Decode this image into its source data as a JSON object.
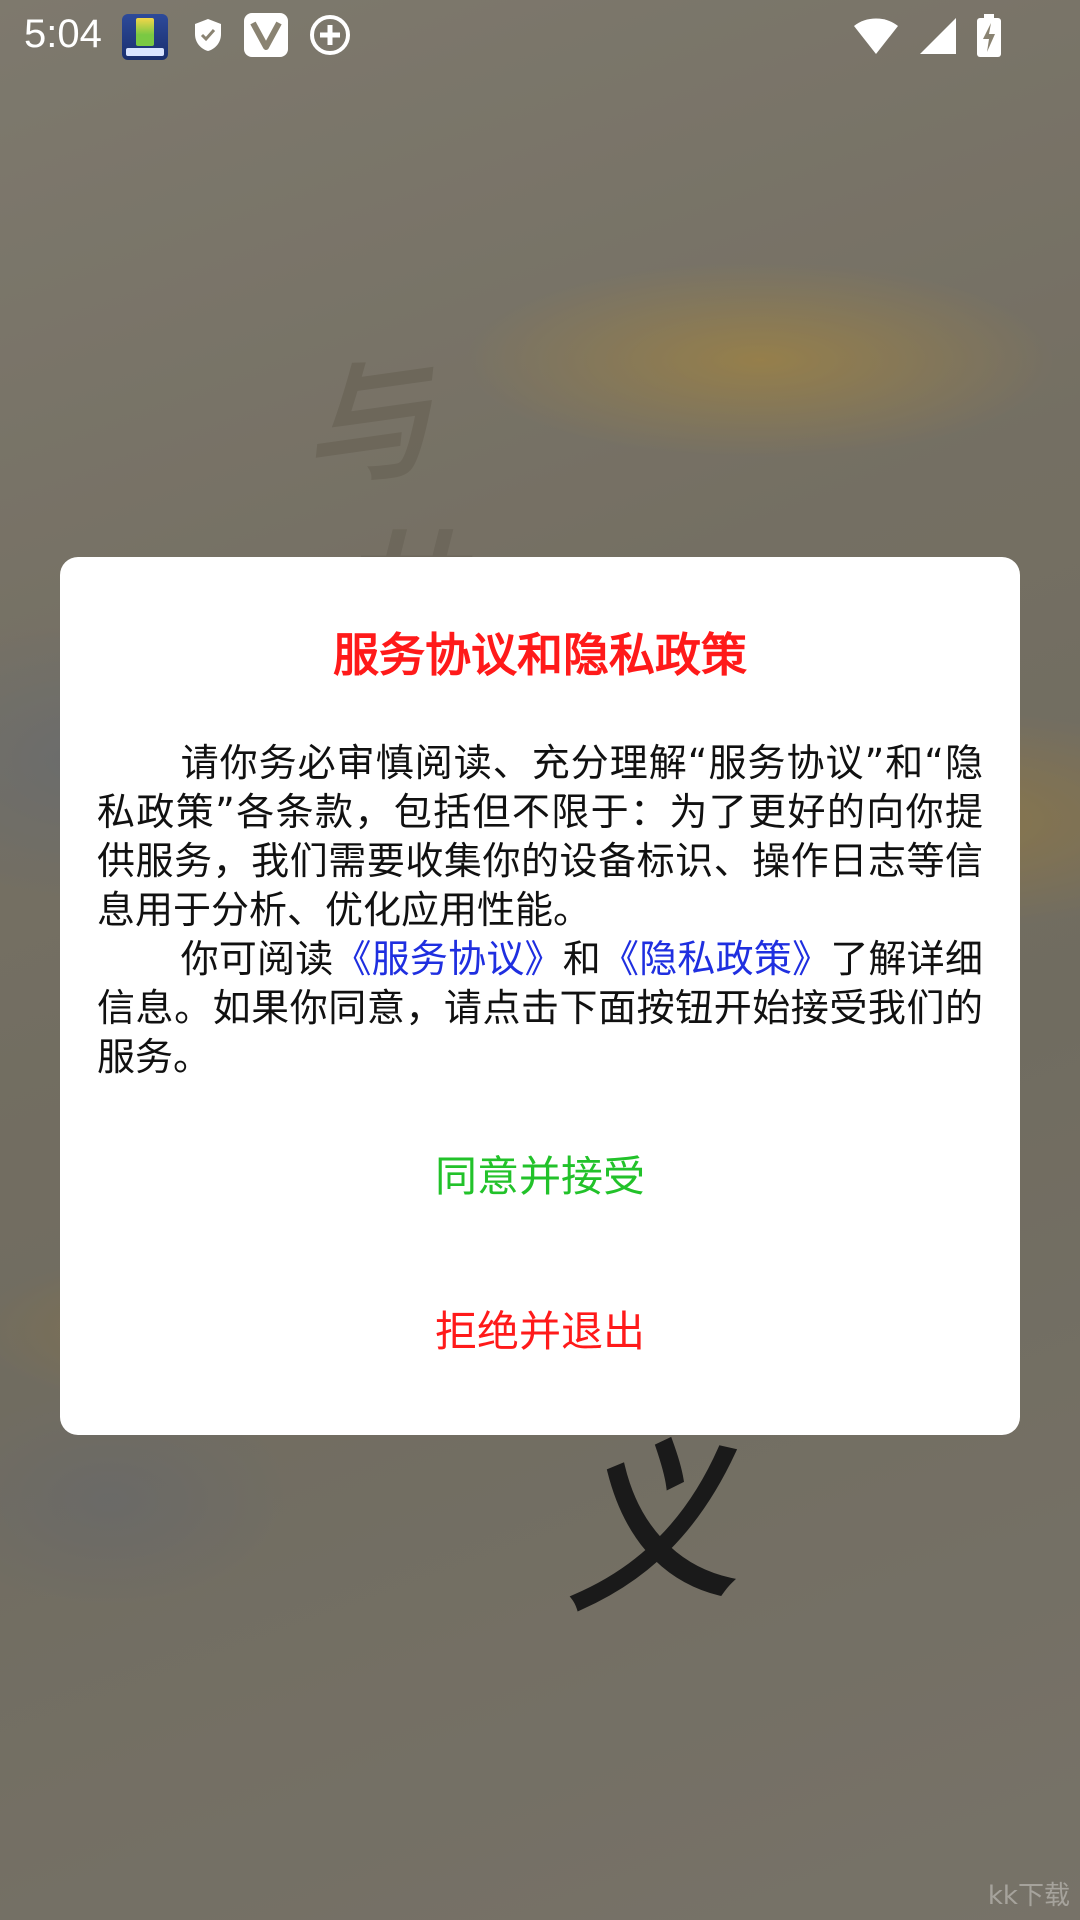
{
  "status_bar": {
    "time": "5:04",
    "left_icons": [
      "battery-app-icon",
      "shield-icon",
      "v-icon",
      "plus-circle-icon"
    ],
    "right_icons": [
      "wifi-icon",
      "signal-icon",
      "battery-charging-icon"
    ]
  },
  "background": {
    "char_top": "与",
    "char_top2": "井",
    "char_bottom": "义",
    "watermark": "kk下载"
  },
  "dialog": {
    "title": "服务协议和隐私政策",
    "paragraph1": "请你务必审慎阅读、充分理解“服务协议”和“隐私政策”各条款，包括但不限于：为了更好的向你提供服务，我们需要收集你的设备标识、操作日志等信息用于分析、优化应用性能。",
    "paragraph2_prefix": "你可阅读",
    "service_link": "《服务协议》",
    "and": "和",
    "privacy_link": "《隐私政策》",
    "paragraph2_suffix": "了解详细信息。如果你同意，请点击下面按钮开始接受我们的服务。",
    "agree_button": "同意并接受",
    "reject_button": "拒绝并退出"
  },
  "colors": {
    "title": "#ff1a1a",
    "link": "#1f2fe0",
    "agree": "#22c22a",
    "reject": "#ff1a1a"
  }
}
